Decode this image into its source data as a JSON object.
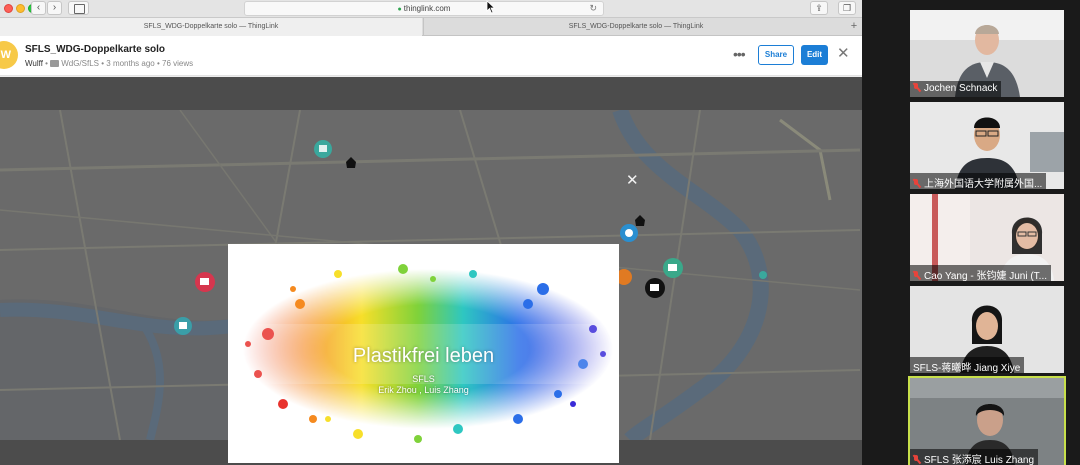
{
  "browser": {
    "url": "thinglink.com",
    "tabs": [
      {
        "label": "SFLS_WDG-Doppelkarte solo — ThingLink",
        "active": true
      },
      {
        "label": "SFLS_WDG-Doppelkarte solo — ThingLink",
        "active": false
      }
    ],
    "new_tab_icon": "plus"
  },
  "header": {
    "avatar_initial": "W",
    "title": "SFLS_WDG-Doppelkarte solo",
    "owner": "Wulff",
    "folder": "WdG/SfLS",
    "age": "3 months ago",
    "views": "76 views",
    "share_label": "Share",
    "edit_label": "Edit",
    "more_icon": "more-horizontal-icon",
    "close_icon": "close-icon"
  },
  "modal": {
    "title": "Plastikfrei leben",
    "subtitle_1": "SFLS",
    "subtitle_2": "Erik Zhou , Luis Zhang",
    "close_icon": "close-icon"
  },
  "participants": [
    {
      "name": "Jochen Schnack",
      "muted": true
    },
    {
      "name": "上海外国语大学附属外国...",
      "muted": true
    },
    {
      "name": "Cao Yang - 张钧婕 Juni (T...",
      "muted": true
    },
    {
      "name": "SFLS-蒋曦晔 Jiang Xiye",
      "muted": false
    },
    {
      "name": "SFLS 张添宸 Luis Zhang",
      "muted": true,
      "speaking": true
    }
  ],
  "colors": {
    "accent": "#1c7ed6",
    "avatar": "#f7c948",
    "speaking_border": "#c8e04a",
    "muted_icon": "#e8433b"
  }
}
